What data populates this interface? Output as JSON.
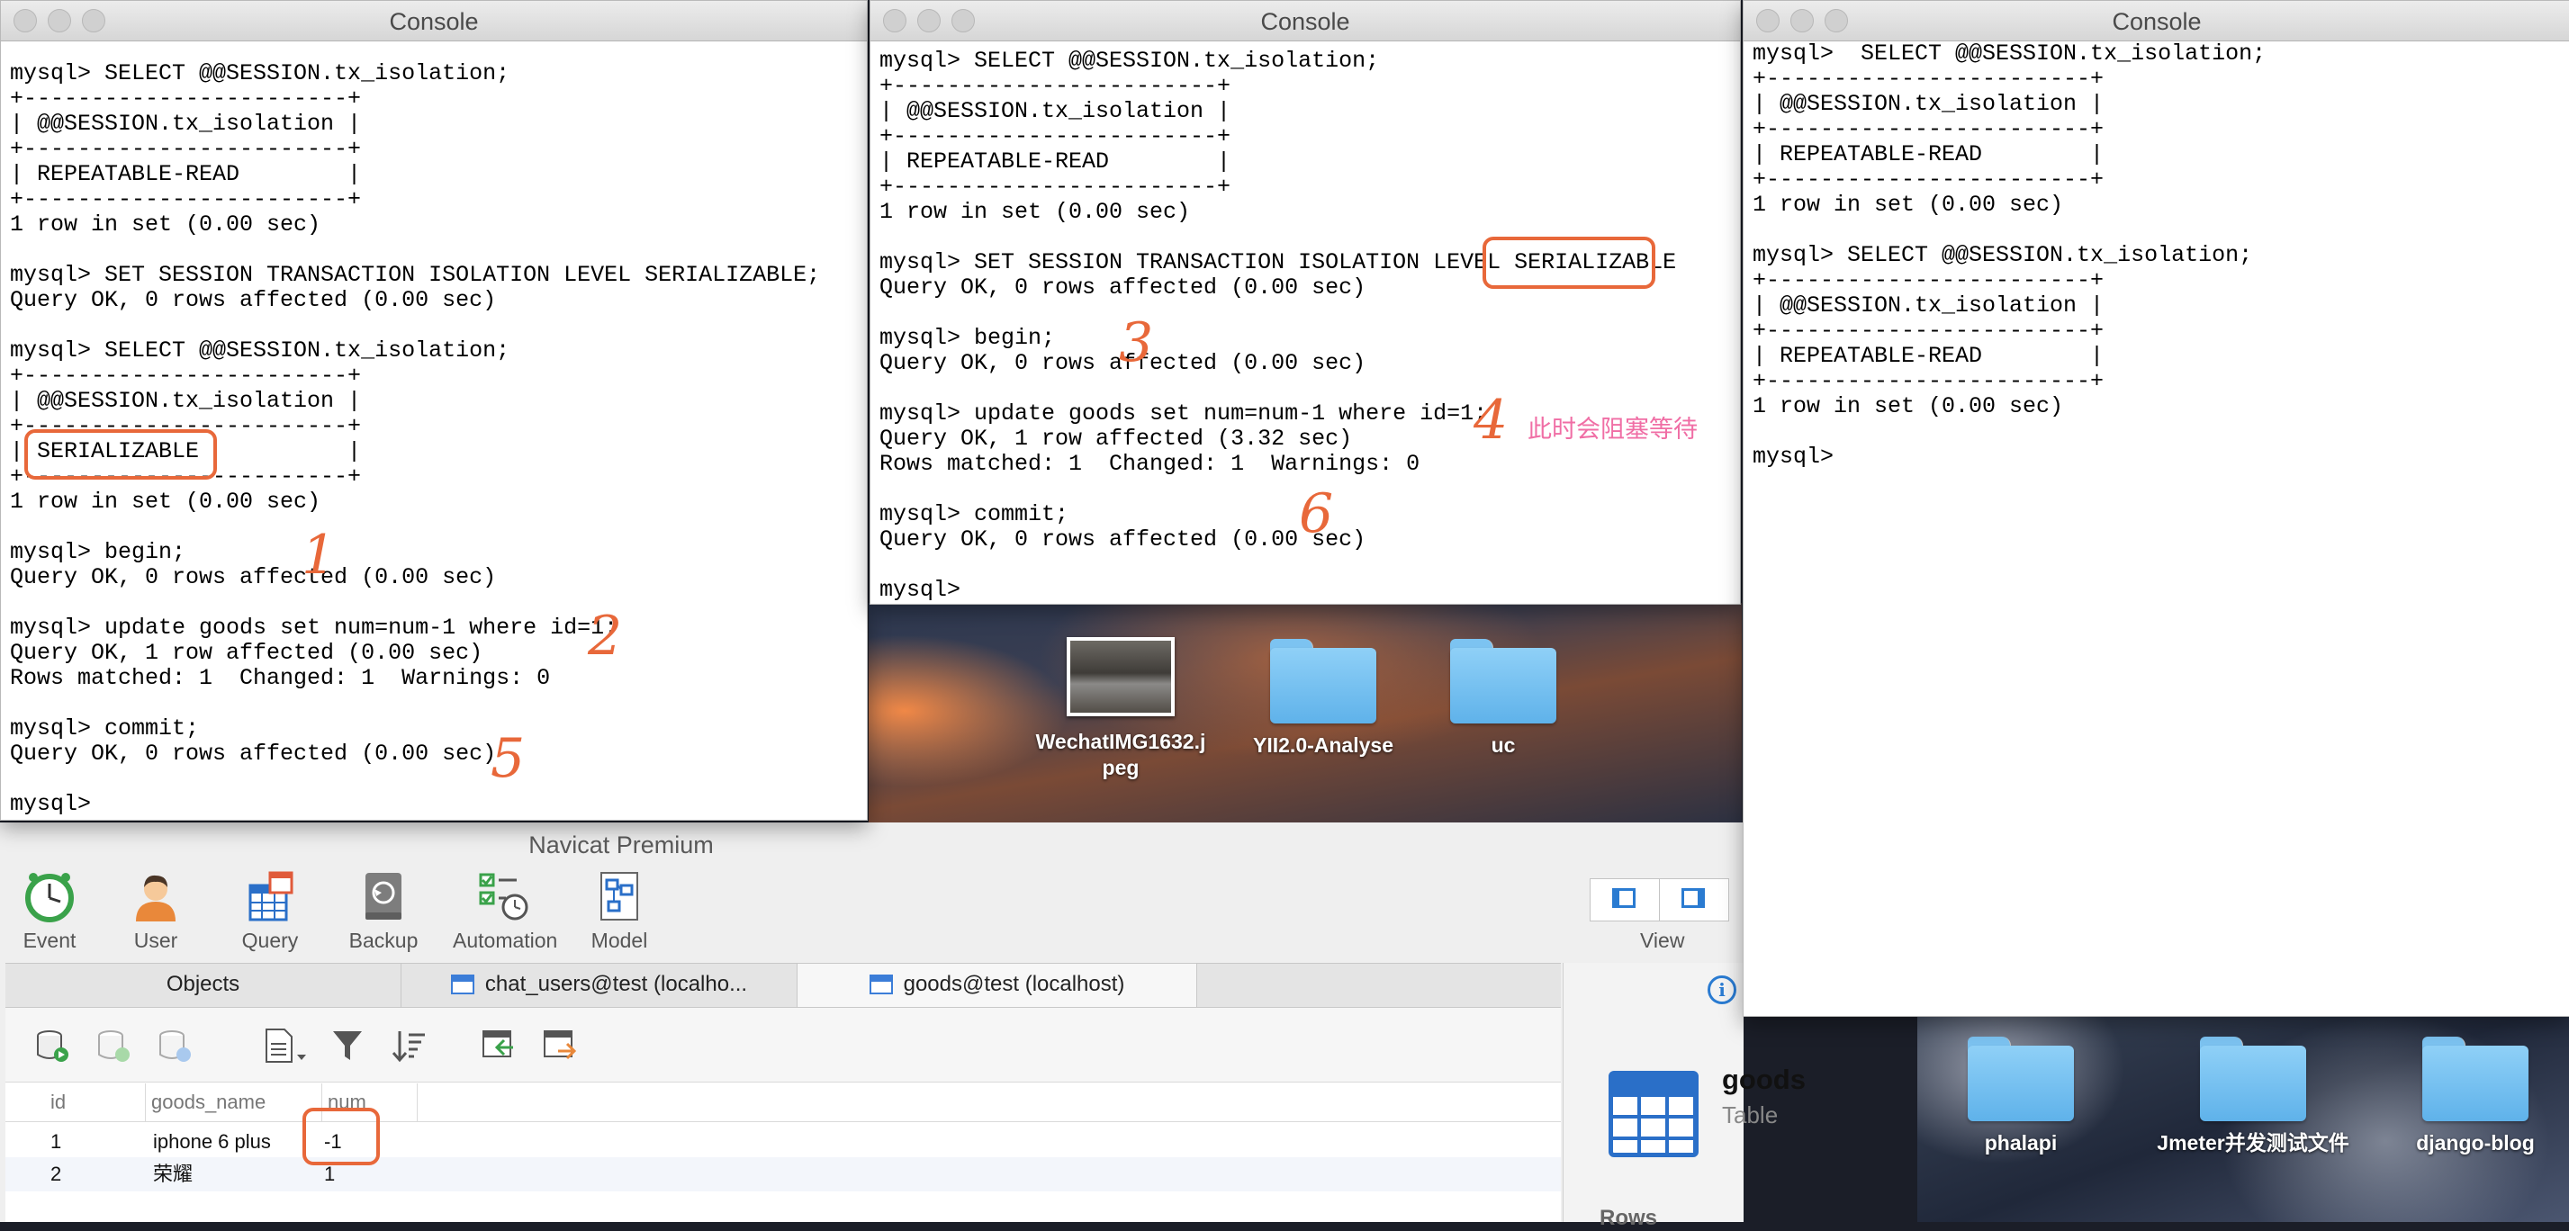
{
  "consoles": {
    "left": {
      "title": "Console",
      "text": "mysql> SELECT @@SESSION.tx_isolation;\n+------------------------+\n| @@SESSION.tx_isolation |\n+------------------------+\n| REPEATABLE-READ        |\n+------------------------+\n1 row in set (0.00 sec)\n\nmysql> SET SESSION TRANSACTION ISOLATION LEVEL SERIALIZABLE;\nQuery OK, 0 rows affected (0.00 sec)\n\nmysql> SELECT @@SESSION.tx_isolation;\n+------------------------+\n| @@SESSION.tx_isolation |\n+------------------------+\n| SERIALIZABLE           |\n+------------------------+\n1 row in set (0.00 sec)\n\nmysql> begin;\nQuery OK, 0 rows affected (0.00 sec)\n\nmysql> update goods set num=num-1 where id=1;\nQuery OK, 1 row affected (0.00 sec)\nRows matched: 1  Changed: 1  Warnings: 0\n\nmysql> commit;\nQuery OK, 0 rows affected (0.00 sec)\n\nmysql>"
    },
    "middle": {
      "title": "Console",
      "text": "mysql> SELECT @@SESSION.tx_isolation;\n+------------------------+\n| @@SESSION.tx_isolation |\n+------------------------+\n| REPEATABLE-READ        |\n+------------------------+\n1 row in set (0.00 sec)\n\nmysql> SET SESSION TRANSACTION ISOLATION LEVEL SERIALIZABLE\nQuery OK, 0 rows affected (0.00 sec)\n\nmysql> begin;\nQuery OK, 0 rows affected (0.00 sec)\n\nmysql> update goods set num=num-1 where id=1;\nQuery OK, 1 row affected (3.32 sec)\nRows matched: 1  Changed: 1  Warnings: 0\n\nmysql> commit;\nQuery OK, 0 rows affected (0.00 sec)\n\nmysql>"
    },
    "right": {
      "title": "Console",
      "text": "mysql>  SELECT @@SESSION.tx_isolation;\n+------------------------+\n| @@SESSION.tx_isolation |\n+------------------------+\n| REPEATABLE-READ        |\n+------------------------+\n1 row in set (0.00 sec)\n\nmysql> SELECT @@SESSION.tx_isolation;\n+------------------------+\n| @@SESSION.tx_isolation |\n+------------------------+\n| REPEATABLE-READ        |\n+------------------------+\n1 row in set (0.00 sec)\n\nmysql>"
    }
  },
  "annotations": {
    "step1": "1",
    "step2": "2",
    "step3": "3",
    "step4": "4",
    "step5": "5",
    "step6": "6",
    "blocking_note": "此时会阻塞等待",
    "highlight_color": "#e8683a"
  },
  "desktop_icons": [
    {
      "label": "WechatIMG1632.jpeg",
      "icon": "image-thumbnail-icon"
    },
    {
      "label": "YII2.0-Analyse",
      "icon": "folder-icon"
    },
    {
      "label": "uc",
      "icon": "folder-icon"
    },
    {
      "label": "phalapi",
      "icon": "folder-icon"
    },
    {
      "label": "Jmeter并发测试文件",
      "icon": "folder-icon"
    },
    {
      "label": "django-blog",
      "icon": "folder-icon"
    }
  ],
  "navicat": {
    "title": "Navicat Premium",
    "toolbar": [
      {
        "label": "Event",
        "icon": "clock-icon"
      },
      {
        "label": "User",
        "icon": "user-icon"
      },
      {
        "label": "Query",
        "icon": "query-icon"
      },
      {
        "label": "Backup",
        "icon": "backup-icon"
      },
      {
        "label": "Automation",
        "icon": "automation-icon"
      },
      {
        "label": "Model",
        "icon": "model-icon"
      }
    ],
    "view_label": "View",
    "tabs": [
      "Objects",
      "chat_users@test (localho...",
      "goods@test (localhost)"
    ],
    "active_tab": 2,
    "columns": [
      "id",
      "goods_name",
      "num"
    ],
    "rows": [
      [
        "1",
        "iphone 6 plus",
        "-1"
      ],
      [
        "2",
        "荣耀",
        "1"
      ]
    ],
    "object_info": {
      "name": "goods",
      "type": "Table",
      "section": "Rows"
    }
  }
}
